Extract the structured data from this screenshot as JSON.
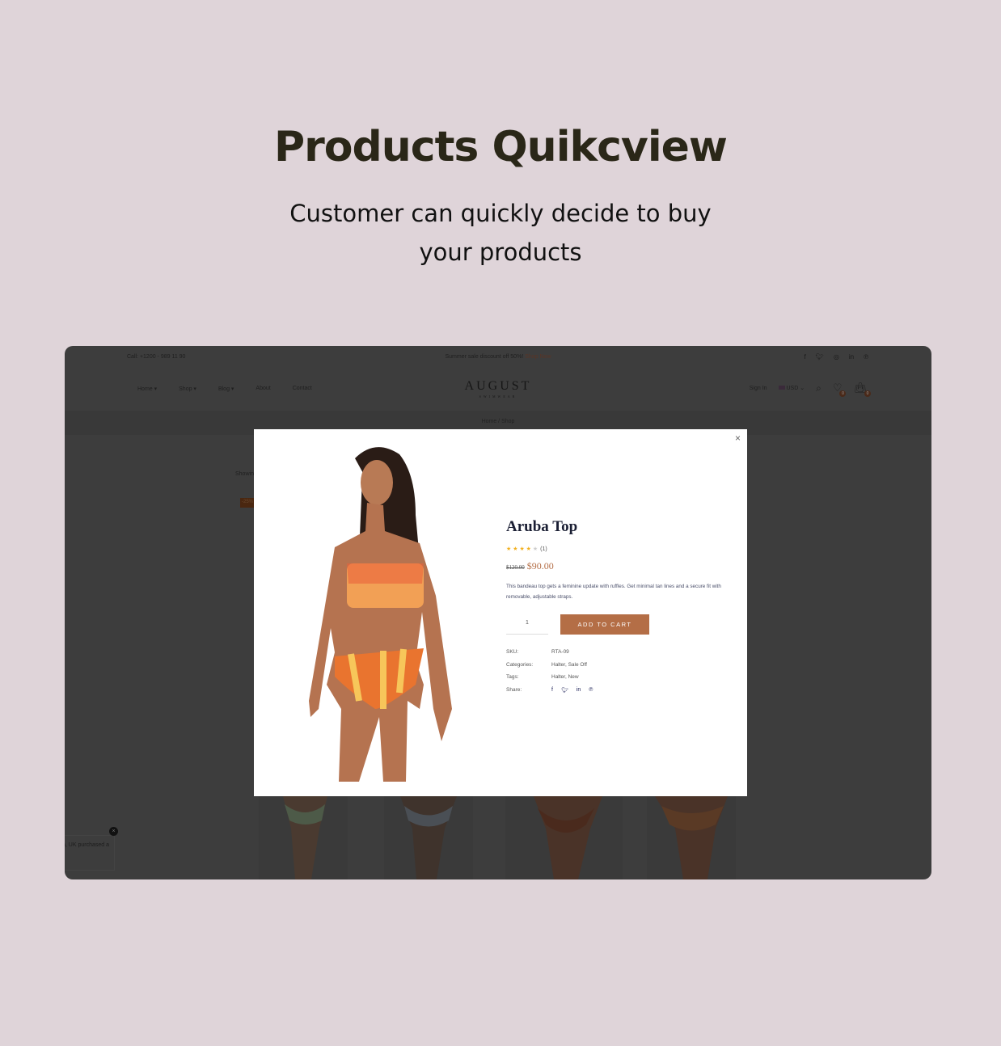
{
  "hero": {
    "title": "Products Quikcview",
    "subtitle_line1": "Customer can quickly decide to buy",
    "subtitle_line2": "your products"
  },
  "topbar": {
    "call": "Call: +1200 - 989 11 90",
    "promo": "Summer sale discount off 50%!",
    "promo_link": "Shop Now",
    "social": [
      "f",
      "t",
      "ig",
      "in",
      "p"
    ]
  },
  "nav": {
    "menu": [
      "Home ▾",
      "Shop ▾",
      "Blog ▾",
      "About",
      "Contact"
    ],
    "logo": "AUGUST",
    "logo_sub": "SWIMWEAR",
    "sign_in": "Sign In",
    "currency": "USD",
    "wishlist_count": "0",
    "cart_count": "0"
  },
  "breadcrumb": "Home / Shop",
  "listing": {
    "showing": "Showing",
    "sale_badge": "-25%"
  },
  "toast": {
    "text": "n, UK purchased a"
  },
  "modal": {
    "name": "Aruba Top",
    "rating": 4,
    "rating_max": 5,
    "review_count": "(1)",
    "old_price": "$120.00",
    "price": "$90.00",
    "description": "This bandeau top gets a feminine update with ruffles. Get minimal tan lines and a secure fit with removable, adjustable straps.",
    "quantity": "1",
    "add_to_cart": "ADD TO CART",
    "sku_label": "SKU:",
    "sku": "RTA-09",
    "categories_label": "Categories:",
    "categories": "Halter, Sale Off",
    "tags_label": "Tags:",
    "tags": "Halter, New",
    "share_label": "Share:",
    "close": "×"
  },
  "colors": {
    "accent": "#b46e46",
    "background": "#dfd4d9",
    "overlay": "#3d3d3d",
    "title": "#2a2718"
  }
}
